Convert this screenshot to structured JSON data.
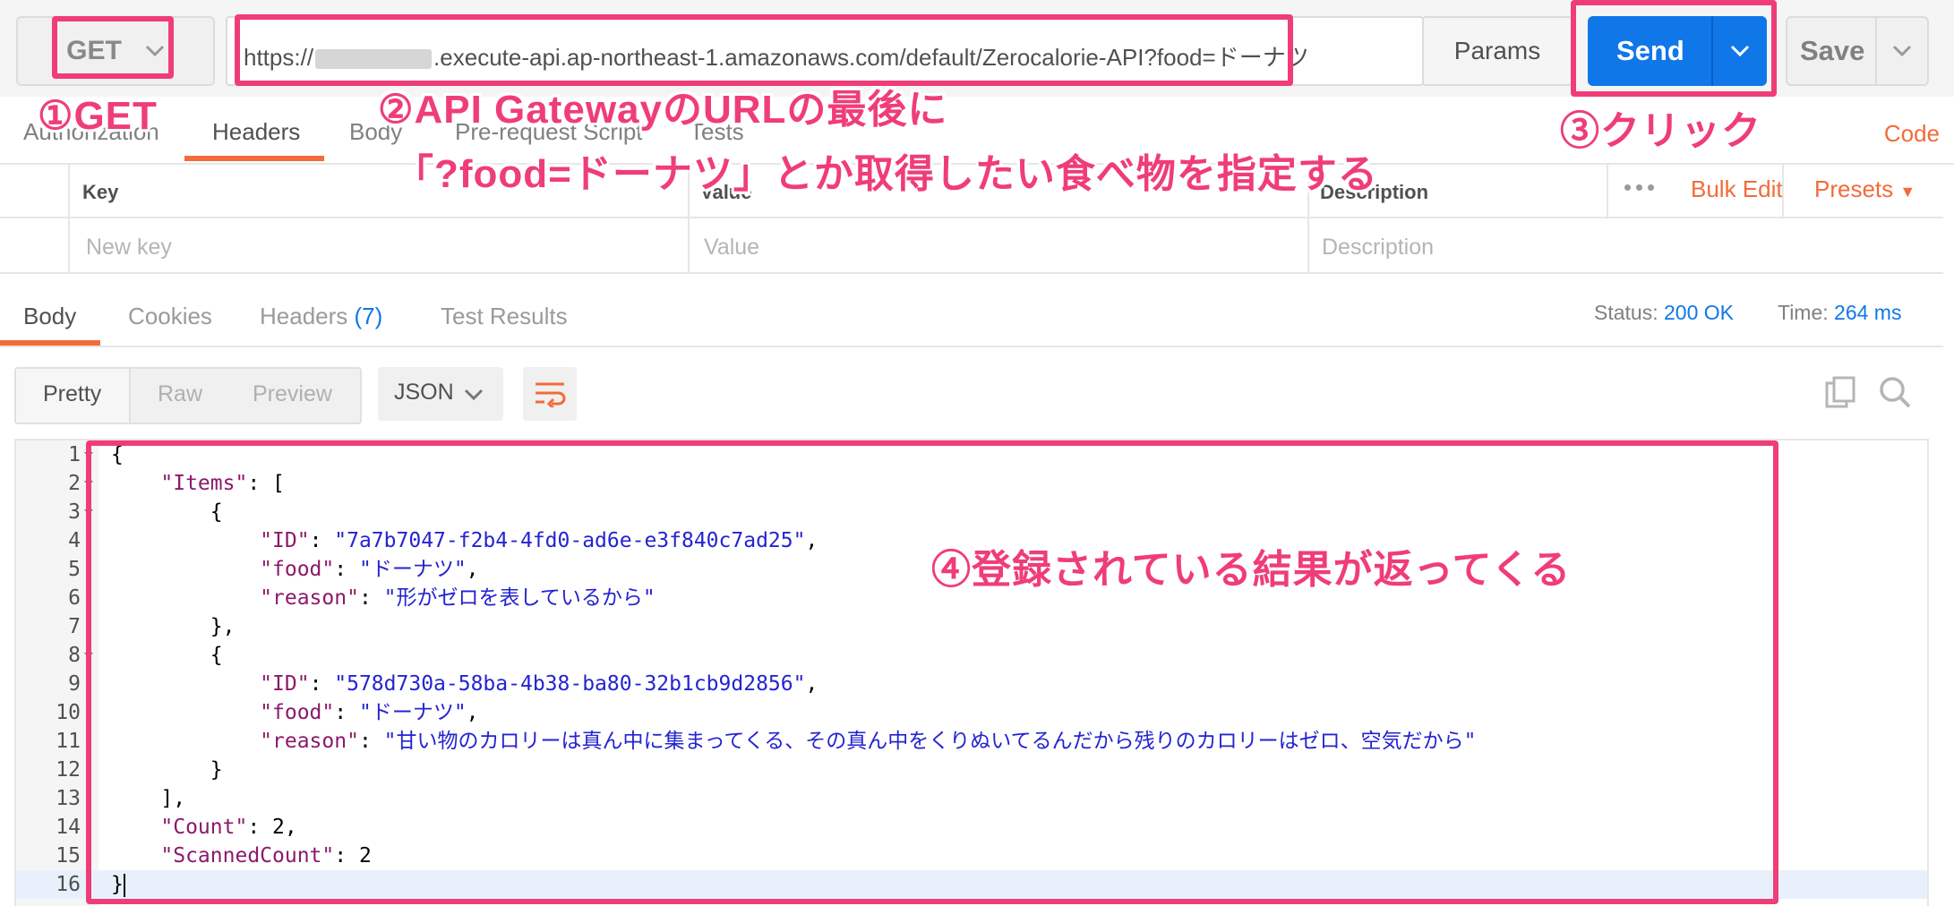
{
  "request": {
    "method": "GET",
    "url_prefix": "https://",
    "url_suffix": ".execute-api.ap-northeast-1.amazonaws.com/default/Zerocalorie-API?food=ドーナツ",
    "params_label": "Params",
    "send_label": "Send",
    "save_label": "Save"
  },
  "request_tabs": {
    "items": [
      "Authorization",
      "Headers",
      "Body",
      "Pre-request Script",
      "Tests"
    ],
    "active": "Headers",
    "code_link": "Code"
  },
  "headers_table": {
    "columns": [
      "Key",
      "Value",
      "Description"
    ],
    "placeholders": {
      "key": "New key",
      "value": "Value",
      "description": "Description"
    },
    "bulk_edit": "Bulk Edit",
    "presets": "Presets"
  },
  "response_tabs": {
    "body": "Body",
    "cookies": "Cookies",
    "headers": "Headers",
    "headers_count": "(7)",
    "test_results": "Test Results"
  },
  "response_meta": {
    "status_label": "Status:",
    "status_value": "200 OK",
    "time_label": "Time:",
    "time_value": "264 ms"
  },
  "format": {
    "modes": [
      "Pretty",
      "Raw",
      "Preview"
    ],
    "active": "Pretty",
    "type": "JSON"
  },
  "body_lines": [
    {
      "n": "1",
      "fold": true,
      "html": "{"
    },
    {
      "n": "2",
      "fold": true,
      "key": "Items",
      "after": ": ["
    },
    {
      "n": "3",
      "fold": true,
      "html": "        {"
    },
    {
      "n": "4",
      "key": "ID",
      "value": "7a7b7047-f2b4-4fd0-ad6e-e3f840c7ad25",
      "comma": true,
      "indent": 3
    },
    {
      "n": "5",
      "key": "food",
      "value": "ドーナツ",
      "comma": true,
      "indent": 3
    },
    {
      "n": "6",
      "key": "reason",
      "value": "形がゼロを表しているから",
      "comma": false,
      "indent": 3
    },
    {
      "n": "7",
      "html": "        },"
    },
    {
      "n": "8",
      "fold": true,
      "html": "        {"
    },
    {
      "n": "9",
      "key": "ID",
      "value": "578d730a-58ba-4b38-ba80-32b1cb9d2856",
      "comma": true,
      "indent": 3
    },
    {
      "n": "10",
      "key": "food",
      "value": "ドーナツ",
      "comma": true,
      "indent": 3
    },
    {
      "n": "11",
      "key": "reason",
      "value": "甘い物のカロリーは真ん中に集まってくる、その真ん中をくりぬいてるんだから残りのカロリーはゼロ、空気だから",
      "comma": false,
      "indent": 3
    },
    {
      "n": "12",
      "html": "        }"
    },
    {
      "n": "13",
      "html": "    ],"
    },
    {
      "n": "14",
      "key": "Count",
      "num": "2",
      "comma": true,
      "indent": 1
    },
    {
      "n": "15",
      "key": "ScannedCount",
      "num": "2",
      "comma": false,
      "indent": 1
    },
    {
      "n": "16",
      "html": "}",
      "cursor": true
    }
  ],
  "annotations": {
    "a1": "①GET",
    "a2_line1": "②API GatewayのURLの最後に",
    "a2_line2": "「?food=ドーナツ」とか取得したい食べ物を指定する",
    "a3": "③クリック",
    "a4": "④登録されている結果が返ってくる",
    "color": "#ef3d78"
  },
  "colors": {
    "accent": "#f26b3a",
    "send": "#1077e8",
    "json_key": "#8b1a6a",
    "json_string": "#2424d0"
  }
}
